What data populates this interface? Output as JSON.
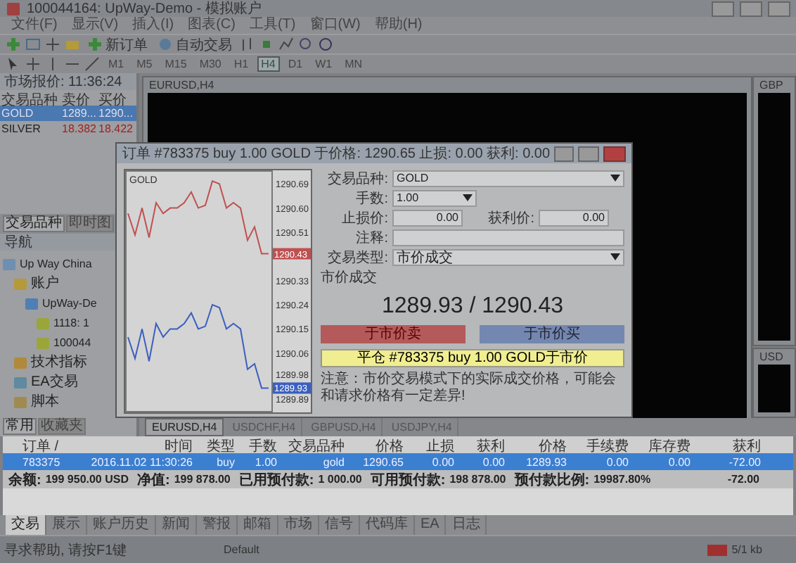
{
  "window": {
    "title": "100044164: UpWay-Demo - 模拟账户"
  },
  "menu": [
    "文件(F)",
    "显示(V)",
    "插入(I)",
    "图表(C)",
    "工具(T)",
    "窗口(W)",
    "帮助(H)"
  ],
  "toolbar": {
    "new_order": "新订单",
    "auto_trading": "自动交易",
    "timeframes": [
      {
        "label": "M1",
        "selected": false
      },
      {
        "label": "M5",
        "selected": false
      },
      {
        "label": "M15",
        "selected": false
      },
      {
        "label": "M30",
        "selected": false
      },
      {
        "label": "H1",
        "selected": false
      },
      {
        "label": "H4",
        "selected": true
      },
      {
        "label": "D1",
        "selected": false
      },
      {
        "label": "W1",
        "selected": false
      },
      {
        "label": "MN",
        "selected": false
      }
    ]
  },
  "market_watch": {
    "title": "市场报价: 11:36:24",
    "columns": [
      "交易品种",
      "卖价",
      "买价"
    ],
    "rows": [
      {
        "symbol": "GOLD",
        "bid": "1289...",
        "ask": "1290...",
        "selected": true
      },
      {
        "symbol": "SILVER",
        "bid": "18.382",
        "ask": "18.422",
        "selected": false
      }
    ],
    "tabs": [
      {
        "label": "交易品种",
        "selected": true
      },
      {
        "label": "即时图",
        "selected": false
      }
    ]
  },
  "navigator": {
    "title": "导航",
    "tree": [
      {
        "label": "Up Way China",
        "kind": "server",
        "children": [
          {
            "label": "账户",
            "kind": "folder",
            "children": [
              {
                "label": "UpWay-De",
                "kind": "account",
                "children": [
                  {
                    "label": "1118: 1",
                    "kind": "user"
                  },
                  {
                    "label": "100044",
                    "kind": "user"
                  }
                ]
              }
            ]
          },
          {
            "label": "技术指标",
            "kind": "indicator"
          },
          {
            "label": "EA交易",
            "kind": "ea"
          },
          {
            "label": "脚本",
            "kind": "script"
          }
        ]
      }
    ],
    "tabs": [
      {
        "label": "常用",
        "selected": true
      },
      {
        "label": "收藏夹",
        "selected": false
      }
    ]
  },
  "charts": [
    {
      "title": "EURUSD,H4"
    },
    {
      "title": "GBP"
    },
    {
      "title": "USD"
    }
  ],
  "chart_tabs": [
    {
      "label": "EURUSD,H4",
      "selected": true
    },
    {
      "label": "USDCHF,H4",
      "selected": false
    },
    {
      "label": "GBPUSD,H4",
      "selected": false
    },
    {
      "label": "USDJPY,H4",
      "selected": false
    }
  ],
  "dialog": {
    "title": "订单 #783375 buy 1.00 GOLD 于价格: 1290.65 止损: 0.00 获利: 0.00",
    "chart": {
      "symbol": "GOLD",
      "ask_tag": "1290.43",
      "bid_tag": "1289.93",
      "chart_data": {
        "type": "line",
        "ylim": [
          1289.85,
          1290.73
        ],
        "yticks": [
          {
            "value": 1290.69,
            "label": "1290.69"
          },
          {
            "value": 1290.6,
            "label": "1290.60"
          },
          {
            "value": 1290.51,
            "label": "1290.51"
          },
          {
            "value": 1290.33,
            "label": "1290.33"
          },
          {
            "value": 1290.24,
            "label": "1290.24"
          },
          {
            "value": 1290.15,
            "label": "1290.15"
          },
          {
            "value": 1290.06,
            "label": "1290.06"
          },
          {
            "value": 1289.98,
            "label": "1289.98"
          },
          {
            "value": 1289.89,
            "label": "1289.89"
          }
        ],
        "series": [
          {
            "color": "#c05050",
            "values": [
              1290.58,
              1290.5,
              1290.6,
              1290.49,
              1290.62,
              1290.58,
              1290.6,
              1290.6,
              1290.62,
              1290.66,
              1290.6,
              1290.61,
              1290.7,
              1290.69,
              1290.6,
              1290.62,
              1290.6,
              1290.48,
              1290.53,
              1290.43,
              1290.43
            ]
          },
          {
            "color": "#3a5fc0",
            "values": [
              1290.12,
              1290.04,
              1290.15,
              1290.03,
              1290.17,
              1290.12,
              1290.15,
              1290.15,
              1290.17,
              1290.21,
              1290.15,
              1290.16,
              1290.24,
              1290.23,
              1290.15,
              1290.17,
              1290.15,
              1290.0,
              1290.02,
              1289.93,
              1289.93
            ]
          }
        ]
      }
    },
    "symbol_label": "交易品种:",
    "symbol": "GOLD",
    "volume_label": "手数:",
    "volume": "1.00",
    "sl_label": "止损价:",
    "sl": "0.00",
    "tp_label": "获利价:",
    "tp": "0.00",
    "comment_label": "注释:",
    "type_label": "交易类型:",
    "type": "市价成交",
    "mode": "市价成交",
    "quote": "1289.93 / 1290.43",
    "sell": "于市价卖",
    "buy": "于市价买",
    "close": "平仓 #783375 buy 1.00 GOLD于市价",
    "note": "注意：市价交易模式下的实际成交价格，可能会和请求价格有一定差异!"
  },
  "terminal": {
    "columns": [
      "订单 /",
      "时间",
      "类型",
      "手数",
      "交易品种",
      "价格",
      "止损",
      "获利",
      "价格",
      "手续费",
      "库存费",
      "获利"
    ],
    "rows": [
      {
        "selected": true,
        "cells": [
          "783375",
          "2016.11.02 11:30:26",
          "buy",
          "1.00",
          "gold",
          "1290.65",
          "0.00",
          "0.00",
          "1289.93",
          "0.00",
          "0.00",
          "-72.00"
        ]
      }
    ],
    "summary": [
      {
        "label": "余额:",
        "value": "199 950.00 USD"
      },
      {
        "label": "净值:",
        "value": "199 878.00"
      },
      {
        "label": "已用预付款:",
        "value": "1 000.00"
      },
      {
        "label": "可用预付款:",
        "value": "198 878.00"
      },
      {
        "label": "预付款比例:",
        "value": "19987.80%"
      }
    ],
    "summary_profit": "-72.00",
    "tabs": [
      {
        "label": "交易",
        "selected": true
      },
      {
        "label": "展示",
        "selected": false
      },
      {
        "label": "账户历史",
        "selected": false
      },
      {
        "label": "新闻",
        "selected": false
      },
      {
        "label": "警报",
        "selected": false
      },
      {
        "label": "邮箱",
        "selected": false
      },
      {
        "label": "市场",
        "selected": false
      },
      {
        "label": "信号",
        "selected": false
      },
      {
        "label": "代码库",
        "selected": false
      },
      {
        "label": "EA",
        "selected": false
      },
      {
        "label": "日志",
        "selected": false
      }
    ]
  },
  "status_bar": {
    "help": "寻求帮助, 请按F1键",
    "profile": "Default",
    "traffic": "5/1 kb"
  }
}
